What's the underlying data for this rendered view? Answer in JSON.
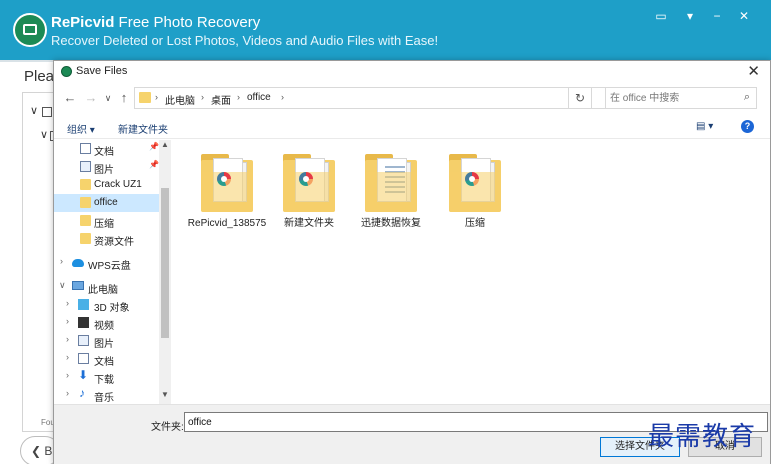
{
  "app": {
    "title_brand": "RePicvid",
    "title_rest": " Free Photo Recovery",
    "subtitle": "Recover Deleted or Lost Photos, Videos and Audio Files with Ease!",
    "please_text": "Pleas",
    "found_text": "Fou",
    "back_label": "B",
    "header_buttons": [
      "feedback-icon",
      "menu-dropdown-icon",
      "minimize-icon",
      "close-icon"
    ]
  },
  "dialog": {
    "title": "Save Files",
    "close_glyph": "✕",
    "address": {
      "segments": [
        "此电脑",
        "桌面",
        "office"
      ]
    },
    "search_placeholder": "在 office 中搜索",
    "toolbar": {
      "organize": "组织 ▾",
      "new_folder": "新建文件夹"
    },
    "nav_items": [
      {
        "label": "文档",
        "icon": "document-icon",
        "pinned": true
      },
      {
        "label": "图片",
        "icon": "picture-icon",
        "pinned": true
      },
      {
        "label": "Crack UZ1",
        "icon": "folder-icon",
        "pinned": false
      },
      {
        "label": "office",
        "icon": "folder-icon",
        "pinned": false,
        "selected": true
      },
      {
        "label": "压缩",
        "icon": "folder-icon",
        "pinned": false
      },
      {
        "label": "资源文件",
        "icon": "folder-icon",
        "pinned": false
      },
      {
        "label": "WPS云盘",
        "icon": "cloud-icon",
        "expandable": true
      },
      {
        "label": "此电脑",
        "icon": "computer-icon",
        "expanded": true
      },
      {
        "label": "3D 对象",
        "icon": "3d-objects-icon",
        "expandable": true
      },
      {
        "label": "视频",
        "icon": "video-icon",
        "expandable": true
      },
      {
        "label": "图片",
        "icon": "picture-icon",
        "expandable": true
      },
      {
        "label": "文档",
        "icon": "document-icon",
        "expandable": true
      },
      {
        "label": "下载",
        "icon": "download-icon",
        "expandable": true
      },
      {
        "label": "音乐",
        "icon": "music-icon",
        "expandable": true
      }
    ],
    "files": [
      {
        "name": "RePicvid_138575",
        "kind": "app-logo"
      },
      {
        "name": "新建文件夹",
        "kind": "app-logo"
      },
      {
        "name": "迅捷数据恢复",
        "kind": "lines"
      },
      {
        "name": "压缩",
        "kind": "app-logo"
      }
    ],
    "filename_label": "文件夹:",
    "filename_value": "office",
    "select_button": "选择文件夹",
    "cancel_button": "取消"
  },
  "watermark": "最需教育",
  "colors": {
    "header": "#1e9fc8",
    "selection": "#cce8ff",
    "folder": "#f5cf6a",
    "watermark": "#1a3aa8"
  }
}
